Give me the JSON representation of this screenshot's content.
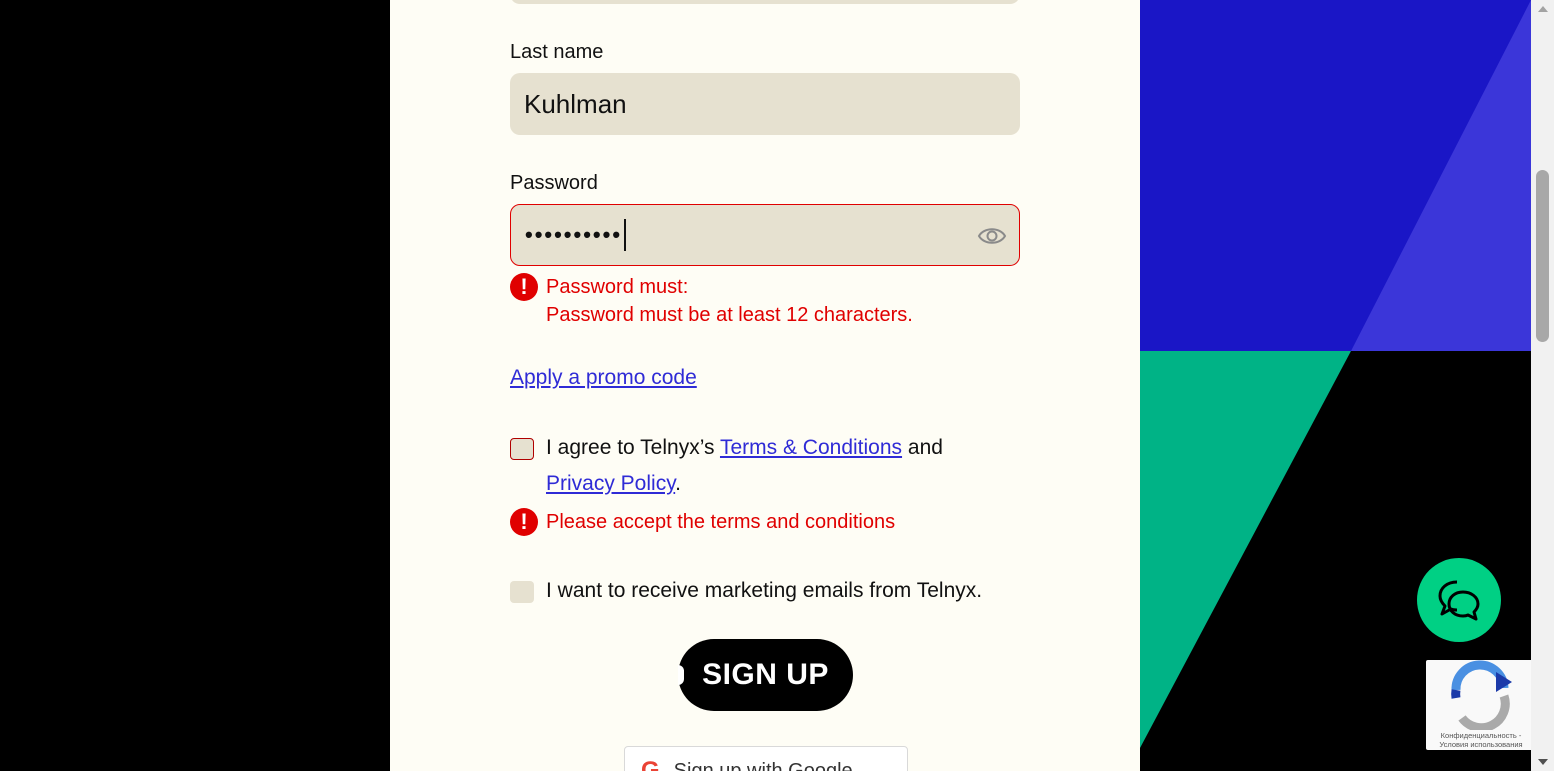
{
  "form": {
    "last_name_label": "Last name",
    "last_name_value": "Kuhlman",
    "password_label": "Password",
    "password_value": "••••••••••",
    "password_error_title": "Password must:",
    "password_error_detail": "Password must be at least 12 characters.",
    "promo_link": "Apply a promo code",
    "terms_prefix": "I agree to Telnyx’s",
    "terms_link": "Terms & Conditions",
    "terms_and": "and",
    "privacy_link": "Privacy Policy",
    "terms_suffix": ".",
    "terms_error": "Please accept the terms and conditions",
    "marketing_label": "I want to receive marketing emails from Telnyx.",
    "signup_button": "SIGN UP",
    "google_button": "Sign up with Google"
  },
  "error_icon_glyph": "!",
  "recaptcha_text": "Конфиденциальность - Условия использования",
  "colors": {
    "error": "#e00000",
    "link": "#2f2bd6",
    "input_bg": "#e6e1d0",
    "page_bg": "#fefdf5",
    "accent_blue": "#1a16c6",
    "accent_green": "#00b386",
    "chat_green": "#00d084"
  },
  "icons": [
    "eye-icon",
    "error-icon",
    "google-icon",
    "chat-icon",
    "recaptcha-icon"
  ]
}
